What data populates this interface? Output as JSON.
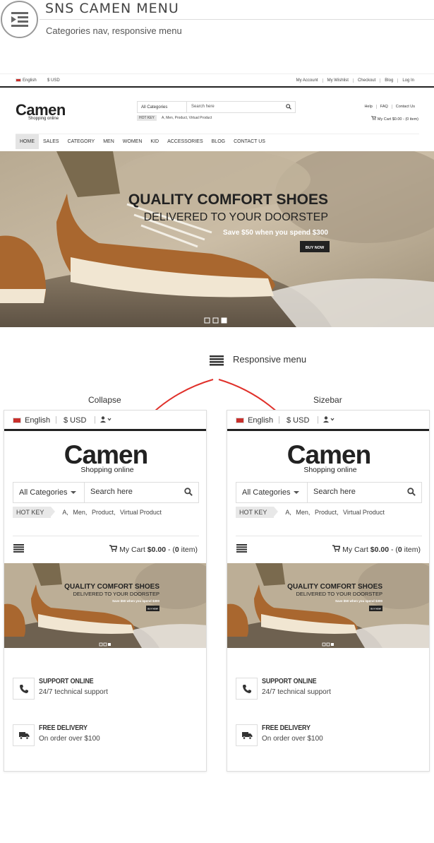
{
  "header": {
    "title": "SNS CAMEN MENU",
    "subtitle": "Categories nav, responsive menu",
    "icon": "menu-indent-icon"
  },
  "desktop": {
    "topbar": {
      "language": "English",
      "currency": "$ USD",
      "links": [
        "My Account",
        "My Wishlist",
        "Checkout",
        "Blog",
        "Log In"
      ]
    },
    "logo": "Camen",
    "logo_sub": "Shopping online",
    "search": {
      "category": "All Categories",
      "placeholder": "Search here"
    },
    "hot_key": {
      "label": "HOT KEY",
      "words": "A,  Men,  Product,  Virtual Product"
    },
    "help_links": [
      "Help",
      "FAQ",
      "Contact Us"
    ],
    "cart": "My Cart $0.00 - (0 item)",
    "nav": [
      "HOME",
      "SALES",
      "CATEGORY",
      "MEN",
      "WOMEN",
      "KID",
      "ACCESSORIES",
      "BLOG",
      "CONTACT US"
    ],
    "banner": {
      "headline": "QUALITY COMFORT SHOES",
      "subline": "DELIVERED TO YOUR DOORSTEP",
      "offer": "Save $50 when you spend $300",
      "button": "BUY NOW"
    }
  },
  "responsive_menu_label": "Responsive menu",
  "labels": {
    "collapse": "Collapse",
    "sizebar": "Sizebar"
  },
  "mobile": {
    "language": "English",
    "currency": "$ USD",
    "logo": "Camen",
    "logo_sub": "Shopping online",
    "search_category": "All Categories",
    "search_placeholder": "Search here",
    "hot_key": "HOT KEY",
    "hot_words": [
      "A,",
      "Men,",
      "Product,",
      "Virtual Product"
    ],
    "cart_prefix": "My Cart",
    "cart_amount": "$0.00",
    "cart_mid": " - (",
    "cart_count": "0",
    "cart_suffix": " item)",
    "banner": {
      "headline": "QUALITY COMFORT SHOES",
      "subline": "DELIVERED TO YOUR DOORSTEP",
      "offer": "Save $50 when you spend $300",
      "button": "BUY NOW"
    },
    "features": [
      {
        "title": "SUPPORT ONLINE",
        "text": "24/7 technical support",
        "icon": "phone-icon"
      },
      {
        "title": "FREE DELIVERY",
        "text": "On order over $100",
        "icon": "truck-icon"
      }
    ]
  },
  "colors": {
    "arrow": "#e0302a",
    "dark": "#222222",
    "accent_bg": "#e4e4e4"
  }
}
